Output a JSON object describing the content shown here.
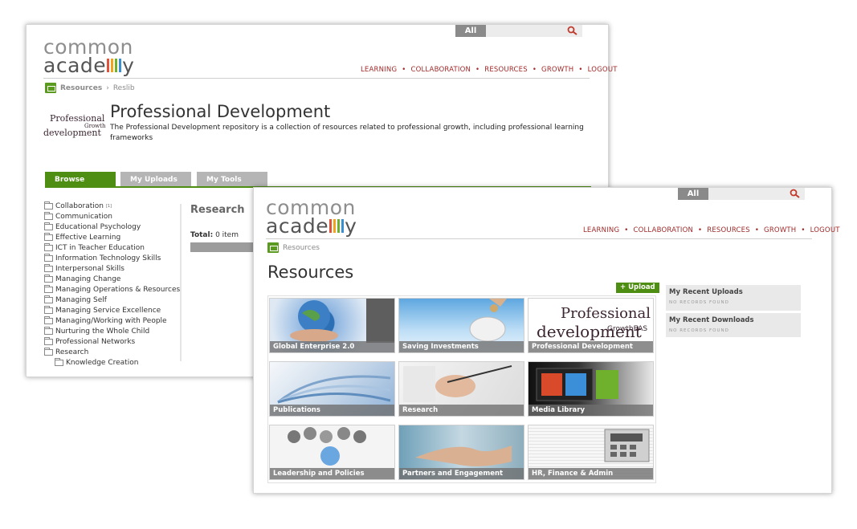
{
  "back_window": {
    "search": {
      "scope": "All"
    },
    "logo": {
      "line1": "common",
      "line2_a": "acade",
      "line2_b": "y"
    },
    "nav": [
      "LEARNING",
      "COLLABORATION",
      "RESOURCES",
      "GROWTH",
      "LOGOUT"
    ],
    "breadcrumb": {
      "root": "Resources",
      "separator": "›",
      "current": "Reslib"
    },
    "page_title": "Professional Development",
    "description": "The Professional Development repository is a collection of resources related to professional growth, including professional learning frameworks",
    "wordcloud": {
      "word1": "Professional",
      "word2": "development",
      "word3": "Growth"
    },
    "tabs": [
      "Browse",
      "My Uploads",
      "My Tools"
    ],
    "tree": [
      {
        "label": "Collaboration",
        "count": "[1]"
      },
      {
        "label": "Communication"
      },
      {
        "label": "Educational Psychology"
      },
      {
        "label": "Effective Learning"
      },
      {
        "label": "ICT in Teacher Education"
      },
      {
        "label": "Information Technology Skills"
      },
      {
        "label": "Interpersonal Skills"
      },
      {
        "label": "Managing Change"
      },
      {
        "label": "Managing Operations & Resources"
      },
      {
        "label": "Managing Self"
      },
      {
        "label": "Managing Service Excellence"
      },
      {
        "label": "Managing/Working with People"
      },
      {
        "label": "Nurturing the Whole Child"
      },
      {
        "label": "Professional Networks"
      },
      {
        "label": "Research"
      }
    ],
    "tree_child": "Knowledge Creation",
    "research_heading": "Research",
    "total_label": "Total:",
    "total_value": "0 item"
  },
  "front_window": {
    "search": {
      "scope": "All"
    },
    "logo": {
      "line1": "common",
      "line2_a": "acade",
      "line2_b": "y"
    },
    "nav": [
      "LEARNING",
      "COLLABORATION",
      "RESOURCES",
      "GROWTH",
      "LOGOUT"
    ],
    "breadcrumb": "Resources",
    "page_title": "Resources",
    "upload_label": "+ Upload",
    "tiles": [
      "Global Enterprise 2.0",
      "Saving Investments",
      "Professional Development",
      "Publications",
      "Research",
      "Media Library",
      "Leadership and Policies",
      "Partners and Engagement",
      "HR, Finance & Admin"
    ],
    "recent_uploads": {
      "title": "My Recent Uploads",
      "empty": "No records found"
    },
    "recent_downloads": {
      "title": "My Recent Downloads",
      "empty": "No records found"
    }
  },
  "colors": {
    "accent_green": "#4e8e12",
    "nav_red": "#a12a2a",
    "logo_bars": [
      "#e0523a",
      "#f2a31b",
      "#6fb02c",
      "#3a8fd1"
    ]
  }
}
